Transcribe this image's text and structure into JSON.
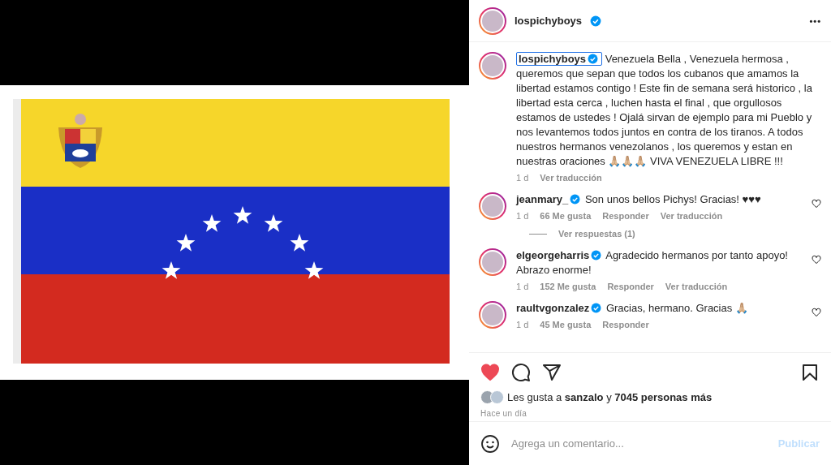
{
  "header": {
    "username": "lospichyboys",
    "more": "•••"
  },
  "caption": {
    "username": "lospichyboys",
    "text": "Venezuela Bella , Venezuela hermosa , queremos que sepan que todos los cubanos que amamos la libertad estamos contigo ! Este fin de semana será historico , la libertad esta cerca , luchen hasta el final , que orgullosos estamos de ustedes ! Ojalá sirvan de ejemplo para mi Pueblo y nos levantemos todos juntos en contra de los tiranos. A todos nuestros hermanos venezolanos , los queremos y estan en nuestras oraciones 🙏🏼🙏🏼🙏🏼 VIVA VENEZUELA LIBRE !!!",
    "time": "1 d",
    "translate": "Ver traducción"
  },
  "comments": [
    {
      "username": "jeanmary_",
      "text": "Son unos bellos Pichys! Gracias! ♥♥♥",
      "time": "1 d",
      "likes": "66 Me gusta",
      "reply": "Responder",
      "translate": "Ver traducción",
      "replies": "Ver respuestas (1)"
    },
    {
      "username": "elgeorgeharris",
      "text": "Agradecido hermanos por tanto apoyo! Abrazo enorme!",
      "time": "1 d",
      "likes": "152 Me gusta",
      "reply": "Responder",
      "translate": "Ver traducción"
    },
    {
      "username": "raultvgonzalez",
      "text": "Gracias, hermano. Gracias 🙏🏼",
      "time": "1 d",
      "likes": "45 Me gusta",
      "reply": "Responder"
    }
  ],
  "actions": {
    "liked": true,
    "likes_summary": "Les gusta a **sanzalo** y **7045 personas más**",
    "posted": "Hace un día"
  },
  "comment_box": {
    "placeholder": "Agrega un comentario...",
    "submit": "Publicar",
    "disabled": true
  }
}
